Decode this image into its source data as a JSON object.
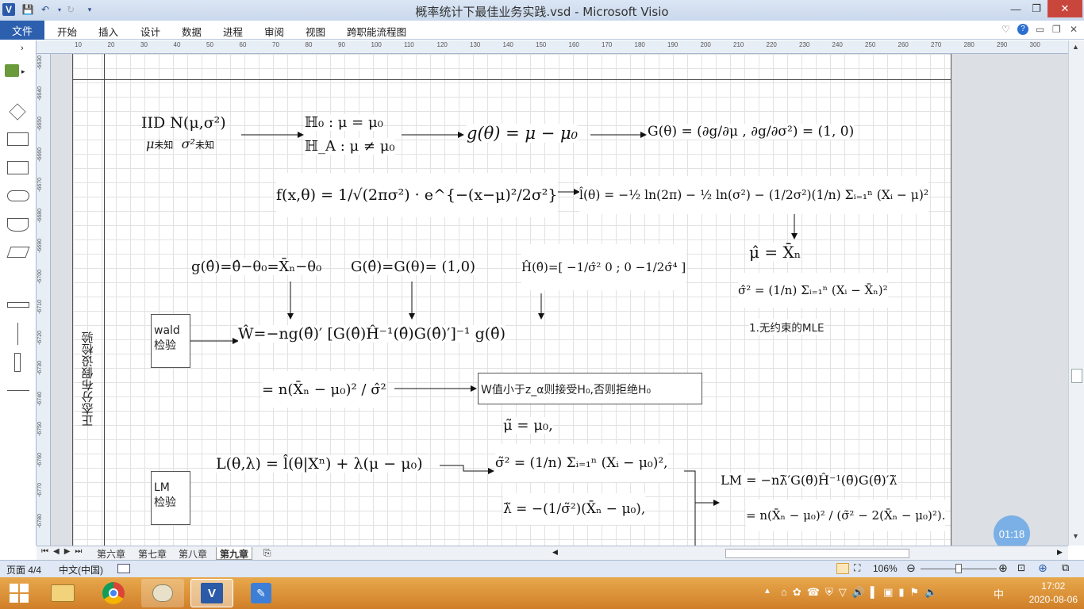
{
  "window": {
    "title": "概率统计下最佳业务实践.vsd - Microsoft Visio"
  },
  "quick_access": {
    "save": "💾",
    "undo": "↶",
    "redo": "↻"
  },
  "menu": {
    "file": "文件",
    "tabs": [
      "开始",
      "插入",
      "设计",
      "数据",
      "进程",
      "审阅",
      "视图",
      "跨职能流程图"
    ]
  },
  "hruler_ticks": [
    "10",
    "20",
    "30",
    "40",
    "50",
    "60",
    "70",
    "80",
    "90",
    "100",
    "110",
    "120",
    "130",
    "140",
    "150",
    "160",
    "170",
    "180",
    "190",
    "200",
    "210",
    "220",
    "230",
    "240",
    "250",
    "260",
    "270",
    "280",
    "290",
    "300"
  ],
  "vruler_ticks": [
    "-6630",
    "-6640",
    "-6650",
    "-6660",
    "-6670",
    "-6680",
    "-6690",
    "-6700",
    "-6710",
    "-6720",
    "-6730",
    "-6740",
    "-6750",
    "-6760",
    "-6770",
    "-6780"
  ],
  "diagram": {
    "swimlane": "正态分布假设检验",
    "iid_top": "IID N(μ,σ²)",
    "iid_mu": "μ",
    "iid_sigma": "σ²",
    "unknown": "未知",
    "h0": "ℍ₀ : μ = μ₀",
    "ha": "ℍ_A : μ ≠ μ₀",
    "g_theta": "g(θ) = μ − μ₀",
    "G_theta": "G(θ) = (∂g/∂μ , ∂g/∂σ²) = (1, 0)",
    "pdf": "f(x,θ) = 1/√(2πσ²) · e^{−(x−μ)²/2σ²}",
    "loglik": "l̂(θ) = −½ ln(2π) − ½ ln(σ²) − (1/2σ²)(1/n) Σᵢ₌₁ⁿ (Xᵢ − μ)²",
    "mu_hat": "μ̂  =  X̄ₙ",
    "sigma_hat": "σ̂² = (1/n) Σᵢ₌₁ⁿ (Xᵢ − X̄ₙ)²",
    "mle_label": "1.无约束的MLE",
    "g_hat": "g(θ̂)=θ̂−θ₀=X̄ₙ−θ₀",
    "G_hat": "G(θ̂)=G(θ)= (1,0)",
    "H_hat": "Ĥ(θ̂)=[ −1/σ̂²  0 ; 0  −1/2σ̂⁴ ]",
    "wald_box": "wald\n检验",
    "wald_stat": "Ŵ=−ng(θ̂)′ [G(θ̂)Ĥ⁻¹(θ̂)G(θ̂)′]⁻¹ g(θ̂)",
    "wald_simpl": "= n(X̄ₙ − μ₀)² / σ̂²",
    "wald_rule": "W值小于z_α则接受H₀,否则拒绝H₀",
    "lagrangian": "L(θ,λ) = l̂(θ|Xⁿ) + λ(μ − μ₀)",
    "mu_tilde": "μ̃  =  μ₀,",
    "sigma_tilde": "σ̃²  =  (1/n) Σᵢ₌₁ⁿ (Xᵢ − μ₀)²,",
    "lambda_tilde": "λ̃  =  −(1/σ̃²)(X̄ₙ − μ₀),",
    "lm_box": "LM\n检验",
    "lm_stat": "LM = −nλ̃′G(θ̃)Ĥ⁻¹(θ̃)G(θ̃)′λ̃",
    "lm_simpl": "= n(X̄ₙ − μ₀)² / (σ̃² − 2(X̄ₙ − μ₀)²)."
  },
  "page_tabs": [
    "第六章",
    "第七章",
    "第八章",
    "第九章"
  ],
  "active_tab": "第九章",
  "timer": "01:18",
  "status": {
    "page": "页面 4/4",
    "language": "中文(中国)",
    "zoom": "106%"
  },
  "clock": {
    "time": "17:02",
    "date": "2020-08-06"
  },
  "ime": "中"
}
